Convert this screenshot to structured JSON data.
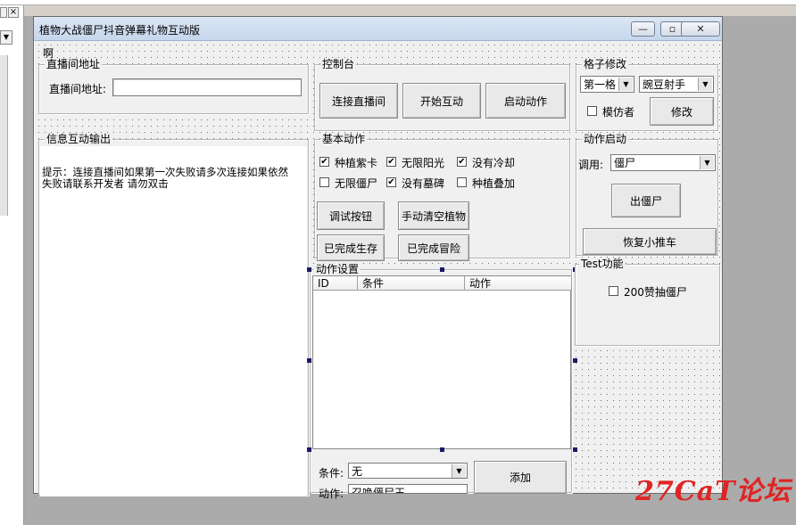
{
  "window": {
    "title": "植物大战僵尸抖音弹幕礼物互动版",
    "menu_label": "啊",
    "min_glyph": "—",
    "max_glyph": "▫",
    "close_glyph": "✕"
  },
  "live": {
    "group_title": "直播间地址",
    "field_label": "直播间地址:",
    "field_value": ""
  },
  "console": {
    "group_title": "控制台",
    "connect": "连接直播间",
    "start": "开始互动",
    "action": "启动动作"
  },
  "grid": {
    "group_title": "格子修改",
    "slot": "第一格",
    "plant": "豌豆射手",
    "imitator": "模仿者",
    "modify": "修改"
  },
  "info": {
    "group_title": "信息互动输出",
    "line1": "提示：连接直播间如果第一次失败请多次连接如果依然",
    "line2": "失败请联系开发者 请勿双击"
  },
  "basic": {
    "group_title": "基本动作",
    "options": [
      {
        "label": "种植紫卡",
        "checked": true
      },
      {
        "label": "无限阳光",
        "checked": true
      },
      {
        "label": "没有冷却",
        "checked": true
      },
      {
        "label": "无限僵尸",
        "checked": false
      },
      {
        "label": "没有墓碑",
        "checked": true
      },
      {
        "label": "种植叠加",
        "checked": false
      }
    ],
    "debug": "调试按钮",
    "clear": "手动清空植物",
    "done_survival": "已完成生存",
    "done_adventure": "已完成冒险"
  },
  "start": {
    "group_title": "动作启动",
    "call_label": "调用:",
    "call_value": "僵尸",
    "spawn": "出僵尸",
    "restore": "恢复小推车"
  },
  "action_settings": {
    "group_title": "动作设置",
    "columns": [
      "ID",
      "条件",
      "动作"
    ],
    "condition_label": "条件:",
    "condition_value": "无",
    "action_label": "动作:",
    "action_value": "召唤僵尸王",
    "add": "添加"
  },
  "test": {
    "group_title": "Test功能",
    "option": "200赞抽僵尸",
    "checked": false
  },
  "watermark": "27CaT论坛",
  "ide": {
    "close_glyph": "×"
  }
}
